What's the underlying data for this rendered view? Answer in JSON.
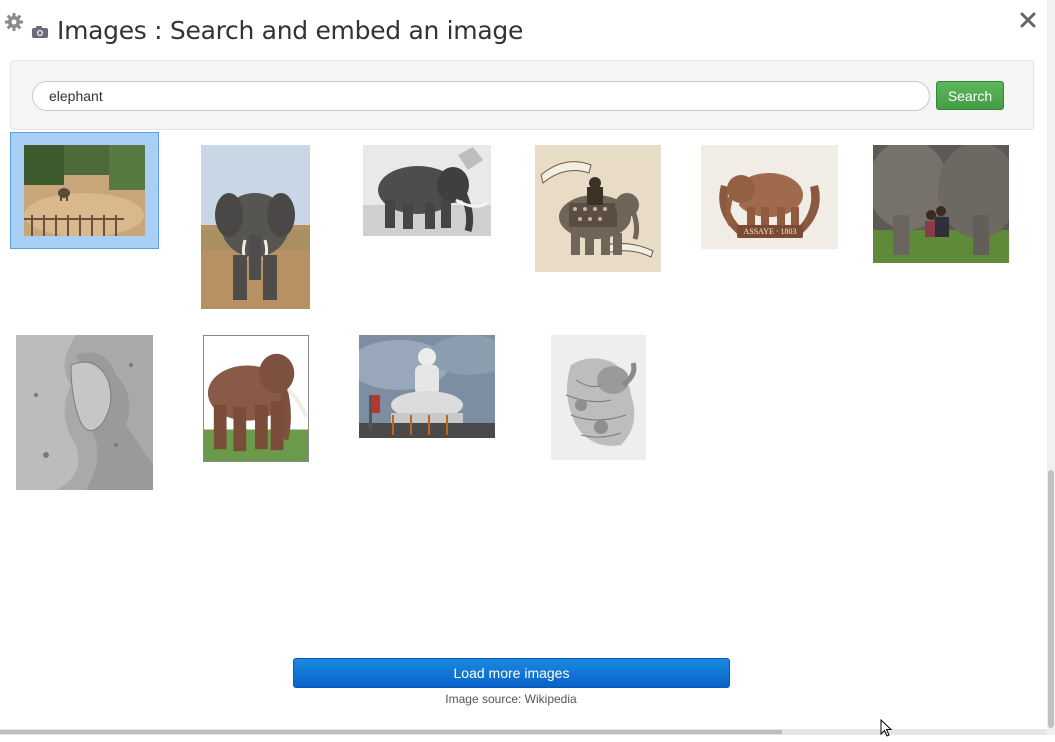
{
  "header": {
    "title": "Images : Search and embed an image",
    "settings_icon": "gear-icon",
    "app_icon": "camera-icon",
    "close_icon": "close-icon"
  },
  "search": {
    "value": "elephant",
    "placeholder": "",
    "button_label": "Search"
  },
  "results": {
    "items": [
      {
        "name": "elephant-enclosure",
        "selected": true
      },
      {
        "name": "african-elephant",
        "selected": false
      },
      {
        "name": "elephant-bw",
        "selected": false
      },
      {
        "name": "war-elephant-illustration",
        "selected": false
      },
      {
        "name": "assaye-badge",
        "selected": false
      },
      {
        "name": "elephants-with-child",
        "selected": false
      },
      {
        "name": "mars-terrain",
        "selected": false
      },
      {
        "name": "elephant-tusks",
        "selected": false
      },
      {
        "name": "buddha-statue",
        "selected": false
      },
      {
        "name": "elephant-engraving",
        "selected": false
      }
    ],
    "badge_text": "ASSAYE · 1803"
  },
  "footer": {
    "load_more_label": "Load more images",
    "source_text": "Image source: Wikipedia"
  },
  "colors": {
    "search_green": "#4cae4c",
    "load_blue": "#0a74d4",
    "selection_blue": "#a9cff5"
  }
}
